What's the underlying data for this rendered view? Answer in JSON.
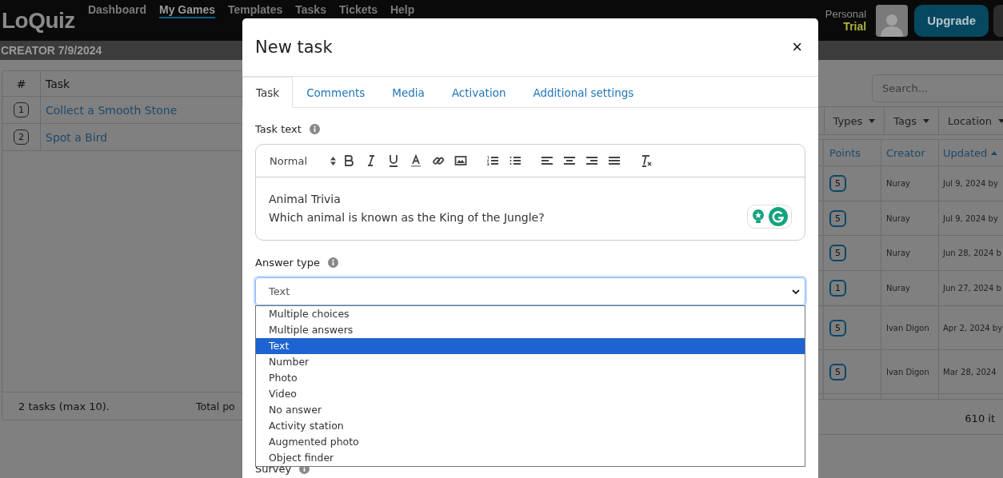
{
  "header": {
    "logo": "LoQuiz",
    "nav": [
      {
        "label": "Dashboard",
        "selected": false
      },
      {
        "label": "My Games",
        "selected": true
      },
      {
        "label": "Templates",
        "selected": false
      },
      {
        "label": "Tasks",
        "selected": false
      },
      {
        "label": "Tickets",
        "selected": false
      },
      {
        "label": "Help",
        "selected": false
      }
    ],
    "plan": {
      "label": "Personal",
      "tier": "Trial"
    },
    "upgrade_button": "Upgrade"
  },
  "page_title": "CREATOR 7/9/2024",
  "game_tasks": {
    "columns": [
      "#",
      "Task"
    ],
    "rows": [
      {
        "number": "1",
        "task": "Collect a Smooth Stone"
      },
      {
        "number": "2",
        "task": "Spot a Bird"
      }
    ],
    "footer": {
      "count": "2 tasks (max 10).",
      "total": "Total po"
    }
  },
  "task_library": {
    "search": {
      "placeholder": "Search..."
    },
    "filters": [
      "Types",
      "Tags",
      "Location"
    ],
    "columns": [
      {
        "label": "Points",
        "sorted": false
      },
      {
        "label": "Creator",
        "sorted": false
      },
      {
        "label": "Updated",
        "sorted": true
      }
    ],
    "rows": [
      {
        "points": "5",
        "creator": "Nuray",
        "updated": "Jul 9, 2024 by"
      },
      {
        "points": "5",
        "creator": "Nuray",
        "updated": "Jul 9, 2024 by"
      },
      {
        "points": "5",
        "creator": "Nuray",
        "updated": "Jun 28, 2024 b"
      },
      {
        "points": "1",
        "creator": "Nuray",
        "updated": "Jun 27, 2024 b"
      },
      {
        "points": "5",
        "creator": "Ivan Digon",
        "updated": "Apr 2, 2024 by"
      },
      {
        "points": "5",
        "creator": "Ivan Digon",
        "updated": "Mar 28, 2024"
      }
    ],
    "footer": "610 it"
  },
  "modal": {
    "title": "New task",
    "close": "×",
    "tabs": [
      {
        "label": "Task",
        "selected": true
      },
      {
        "label": "Comments",
        "selected": false
      },
      {
        "label": "Media",
        "selected": false
      },
      {
        "label": "Activation",
        "selected": false
      },
      {
        "label": "Additional settings",
        "selected": false
      }
    ],
    "task_text": {
      "label": "Task text",
      "format": "Normal",
      "lines": [
        "Animal Trivia",
        "Which animal is known as the King of the Jungle?"
      ]
    },
    "answer_type": {
      "label": "Answer type",
      "value": "Text",
      "open": true,
      "options": [
        {
          "label": "Multiple choices",
          "selected": false
        },
        {
          "label": "Multiple answers",
          "selected": false
        },
        {
          "label": "Text",
          "selected": true
        },
        {
          "label": "Number",
          "selected": false
        },
        {
          "label": "Photo",
          "selected": false
        },
        {
          "label": "Video",
          "selected": false
        },
        {
          "label": "No answer",
          "selected": false
        },
        {
          "label": "Activity station",
          "selected": false
        },
        {
          "label": "Augmented photo",
          "selected": false
        },
        {
          "label": "Object finder",
          "selected": false
        }
      ]
    },
    "next_label": "Survey"
  }
}
